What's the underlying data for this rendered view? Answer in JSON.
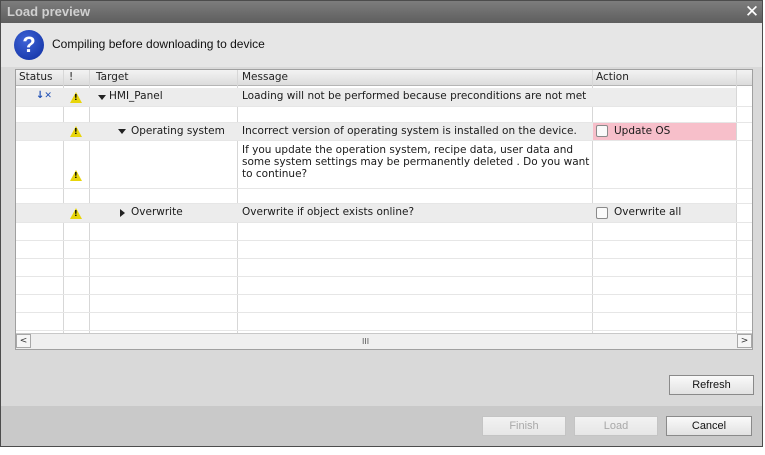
{
  "window": {
    "title": "Load preview",
    "close_glyph": "✕"
  },
  "header": {
    "icon": "question-icon",
    "message": "Compiling before downloading to device"
  },
  "table": {
    "columns": [
      "Status",
      "!",
      "Target",
      "Message",
      "Action"
    ],
    "rows": [
      {
        "target": "HMI_Panel",
        "message": "Loading will not be performed because preconditions are not met",
        "action": ""
      },
      {
        "target": "Operating system",
        "message": "Incorrect version of operating system is installed on the device.",
        "action": "Update OS"
      },
      {
        "target": "",
        "message_lines": [
          "If you update the operation system, recipe data, user data and",
          "some system settings may be permanently deleted . Do you want",
          "to continue?"
        ],
        "action": ""
      },
      {
        "target": "Overwrite",
        "message": "Overwrite if object exists online?",
        "action": "Overwrite all"
      }
    ]
  },
  "scrollbar": {
    "left": "<",
    "right": ">",
    "grip": "III"
  },
  "buttons": {
    "refresh": "Refresh",
    "finish": "Finish",
    "load": "Load",
    "cancel": "Cancel"
  },
  "colors": {
    "action_highlight": "#f7bfca",
    "warning": "#e8d50a",
    "title_bar": "#6a6a6a"
  }
}
